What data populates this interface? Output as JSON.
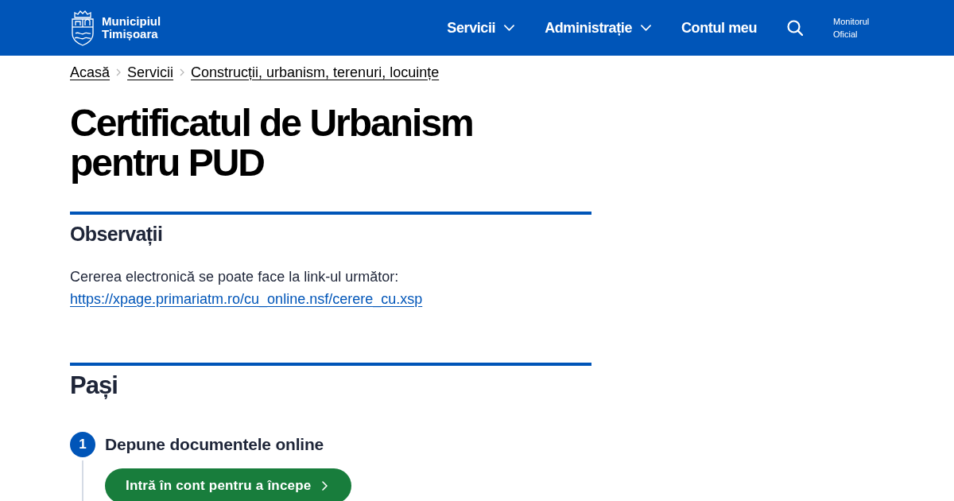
{
  "header": {
    "logo": {
      "line_1": "Municipiul",
      "line_2": "Timișoara"
    },
    "nav": [
      {
        "label": "Servicii",
        "has_menu": true
      },
      {
        "label": "Administrație",
        "has_menu": true
      },
      {
        "label": "Contul meu",
        "has_menu": false
      }
    ],
    "monitor_link": {
      "line_1": "Monitorul",
      "line_2": "Oficial"
    }
  },
  "breadcrumb": [
    "Acasă",
    "Servicii",
    "Construcții, urbanism, terenuri, locuințe"
  ],
  "title": "Certificatul de Urbanism pentru PUD",
  "observations": {
    "heading": "Observații",
    "text": "Cererea electronică se poate face la link-ul următor:",
    "link": "https://xpage.primariatm.ro/cu_online.nsf/cerere_cu.xsp"
  },
  "steps": {
    "heading": "Pași",
    "items": [
      {
        "number": "1",
        "title": "Depune documentele online",
        "button": "Intră în cont pentru a începe"
      }
    ]
  }
}
